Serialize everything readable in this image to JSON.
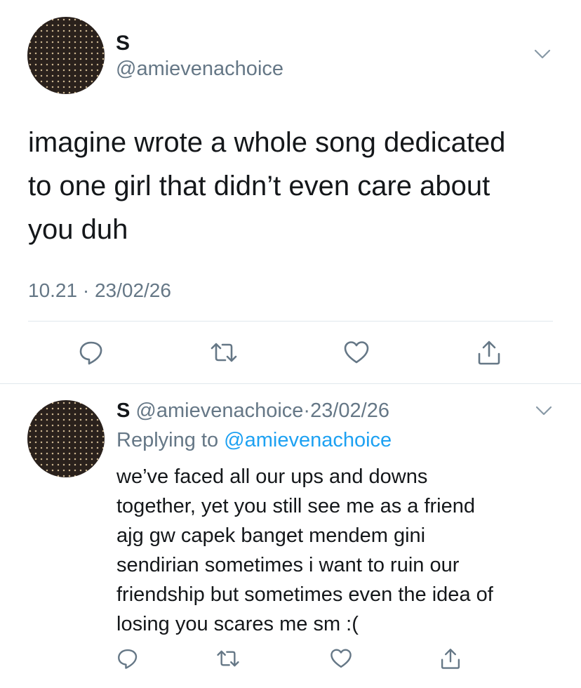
{
  "main_tweet": {
    "display_name": "S",
    "handle": "@amievenachoice",
    "text_lines": [
      "imagine wrote a whole song dedicated",
      "to one girl that didn’t even care about",
      "you duh"
    ],
    "timestamp": "10.21 · 23/02/26"
  },
  "reply_tweet": {
    "display_name": "S",
    "handle": "@amievenachoice",
    "dot": "·",
    "date": "23/02/26",
    "replying_prefix": "Replying to",
    "replying_handle": "@amievenachoice",
    "text_lines": [
      "we’ve faced all our ups and downs",
      "together, yet you still see me as a friend",
      "ajg gw capek banget mendem gini",
      "sendirian sometimes i want to ruin our",
      "friendship but sometimes even the idea of",
      "losing you scares me sm :("
    ]
  },
  "icons": {
    "menu": "chevron-down-icon",
    "reply": "reply-icon",
    "retweet": "retweet-icon",
    "like": "heart-icon",
    "share": "share-icon"
  },
  "colors": {
    "text": "#14171a",
    "muted": "#657786",
    "link": "#1da1f2",
    "divider": "#e1e8ed"
  }
}
